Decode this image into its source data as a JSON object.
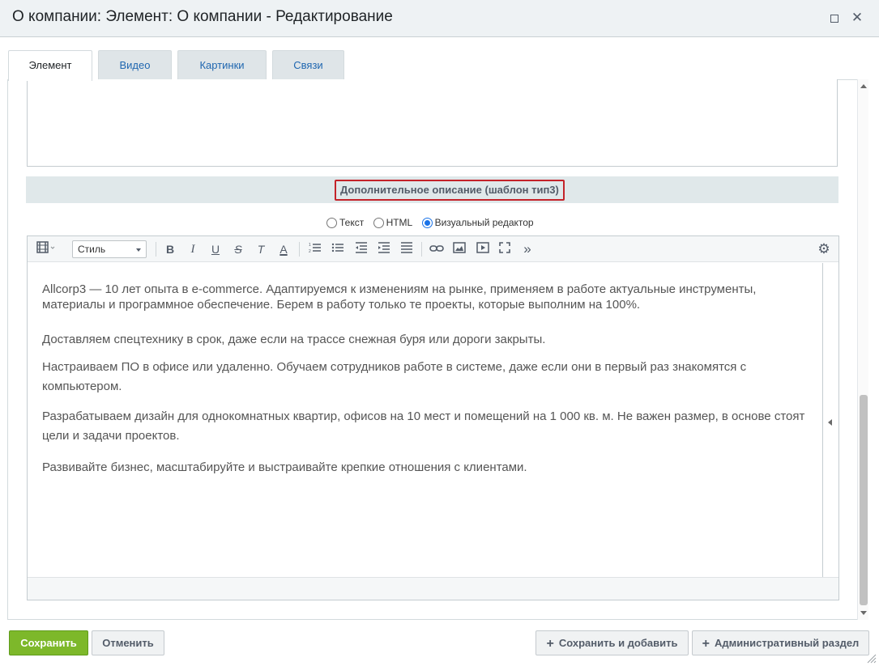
{
  "window": {
    "title": "О компании: Элемент: О компании - Редактирование",
    "maximize_icon": "maximize-icon",
    "close_icon": "close-icon",
    "close_glyph": "✕"
  },
  "tabs": [
    {
      "label": "Элемент",
      "active": true
    },
    {
      "label": "Видео",
      "active": false
    },
    {
      "label": "Картинки",
      "active": false
    },
    {
      "label": "Связи",
      "active": false
    }
  ],
  "section": {
    "title": "Дополнительное описание (шаблон тип3)"
  },
  "editor_modes": [
    {
      "label": "Текст",
      "checked": false
    },
    {
      "label": "HTML",
      "checked": false
    },
    {
      "label": "Визуальный редактор",
      "checked": true
    }
  ],
  "toolbar": {
    "style_select_value": "Стиль",
    "buttons": [
      "template-icon",
      "bold-icon",
      "italic-icon",
      "underline-icon",
      "strikethrough-icon",
      "remove-format-icon",
      "font-color-icon",
      "ordered-list-icon",
      "unordered-list-icon",
      "outdent-icon",
      "indent-icon",
      "align-icon",
      "link-icon",
      "image-icon",
      "video-icon",
      "fullscreen-icon",
      "more-icon",
      "settings-icon"
    ],
    "glyphs": {
      "bold": "B",
      "italic": "I",
      "underline": "U",
      "strike": "S",
      "remove_format": "T",
      "font_color": "A",
      "more": "»",
      "settings": "⚙"
    }
  },
  "content": {
    "paragraphs": [
      "Allcorp3 — 10 лет опыта в e-commerce. Адаптируемся к изменениям на рынке, применяем в работе актуальные инструменты, материалы и программное обеспечение. Берем в работу только те проекты, которые выполним на 100%.",
      "Доставляем спецтехнику в срок, даже если на трассе снежная буря или дороги закрыты.",
      "Настраиваем ПО в офисе или удаленно. Обучаем сотрудников работе в системе, даже если они в первый раз знакомятся с компьютером.",
      "Разрабатываем дизайн для однокомнатных квартир, офисов на 10 мест и помещений на 1 000 кв. м. Не важен размер, в основе стоят цели и задачи проектов.",
      "Развивайте бизнес, масштабируйте и выстраивайте крепкие отношения с клиентами."
    ]
  },
  "footer": {
    "save": "Сохранить",
    "cancel": "Отменить",
    "save_and_add": "Сохранить и добавить",
    "admin_section": "Административный раздел",
    "plus_glyph": "+"
  },
  "colors": {
    "save_button": "#7db82a",
    "highlight_border": "#c4232a",
    "accent_link": "#2067b0"
  }
}
